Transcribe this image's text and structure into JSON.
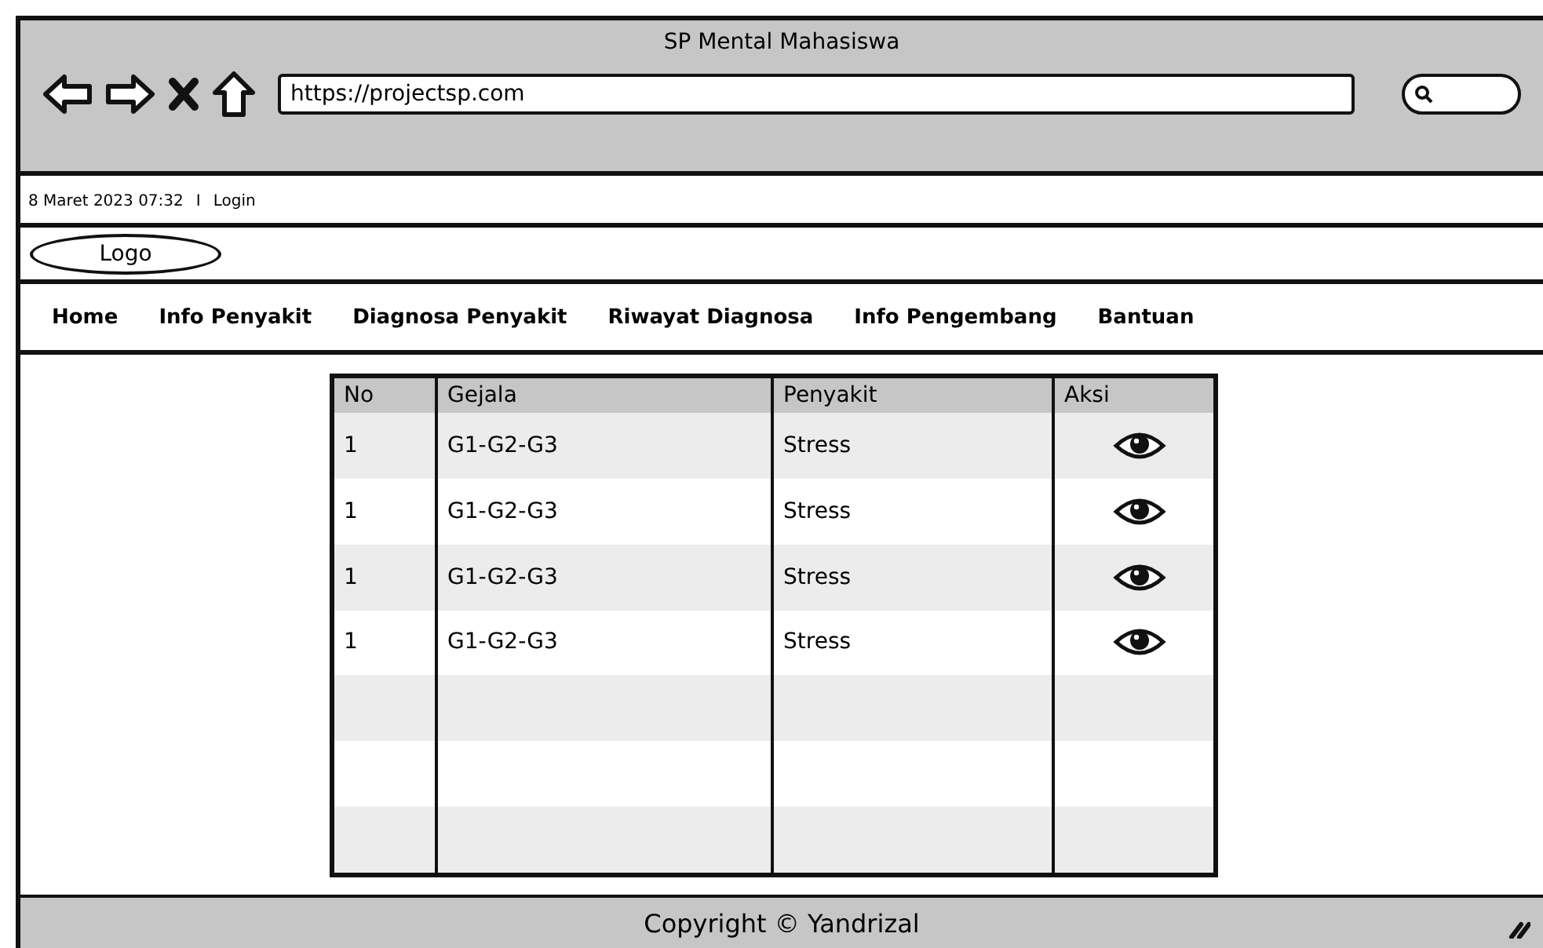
{
  "window": {
    "title": "SP Mental Mahasiswa"
  },
  "browser": {
    "url": "https://projectsp.com"
  },
  "top_bar": {
    "datetime": "8 Maret 2023 07:32",
    "separator": "I",
    "login": "Login"
  },
  "logo": "Logo",
  "nav": [
    "Home",
    "Info Penyakit",
    "Diagnosa Penyakit",
    "Riwayat Diagnosa",
    "Info Pengembang",
    "Bantuan"
  ],
  "table": {
    "columns": [
      "No",
      "Gejala",
      "Penyakit",
      "Aksi"
    ],
    "rows": [
      {
        "no": "1",
        "gejala": "G1-G2-G3",
        "penyakit": "Stress"
      },
      {
        "no": "1",
        "gejala": "G1-G2-G3",
        "penyakit": "Stress"
      },
      {
        "no": "1",
        "gejala": "G1-G2-G3",
        "penyakit": "Stress"
      },
      {
        "no": "1",
        "gejala": "G1-G2-G3",
        "penyakit": "Stress"
      }
    ]
  },
  "footer": "Copyright © Yandrizal"
}
